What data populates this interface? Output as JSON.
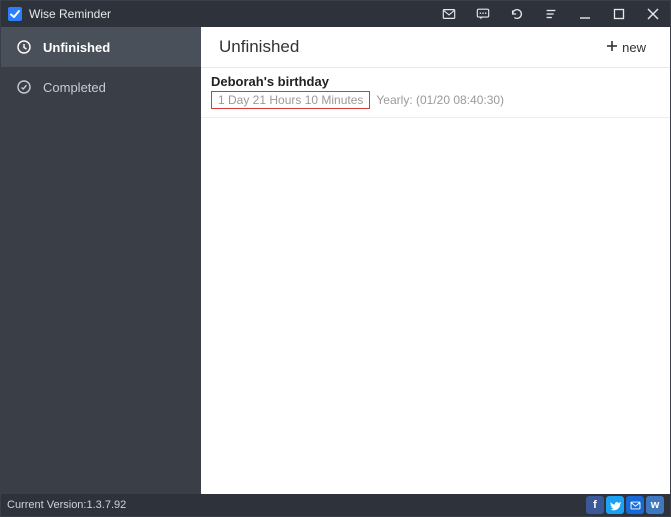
{
  "app": {
    "title": "Wise Reminder"
  },
  "sidebar": {
    "items": [
      {
        "label": "Unfinished"
      },
      {
        "label": "Completed"
      }
    ]
  },
  "main": {
    "heading": "Unfinished",
    "new_label": "new"
  },
  "tasks": [
    {
      "title": "Deborah's birthday",
      "countdown": "1 Day  21 Hours  10 Minutes",
      "recurrence": "Yearly: (01/20 08:40:30)"
    }
  ],
  "footer": {
    "version_label": "Current Version:",
    "version_value": "1.3.7.92"
  }
}
